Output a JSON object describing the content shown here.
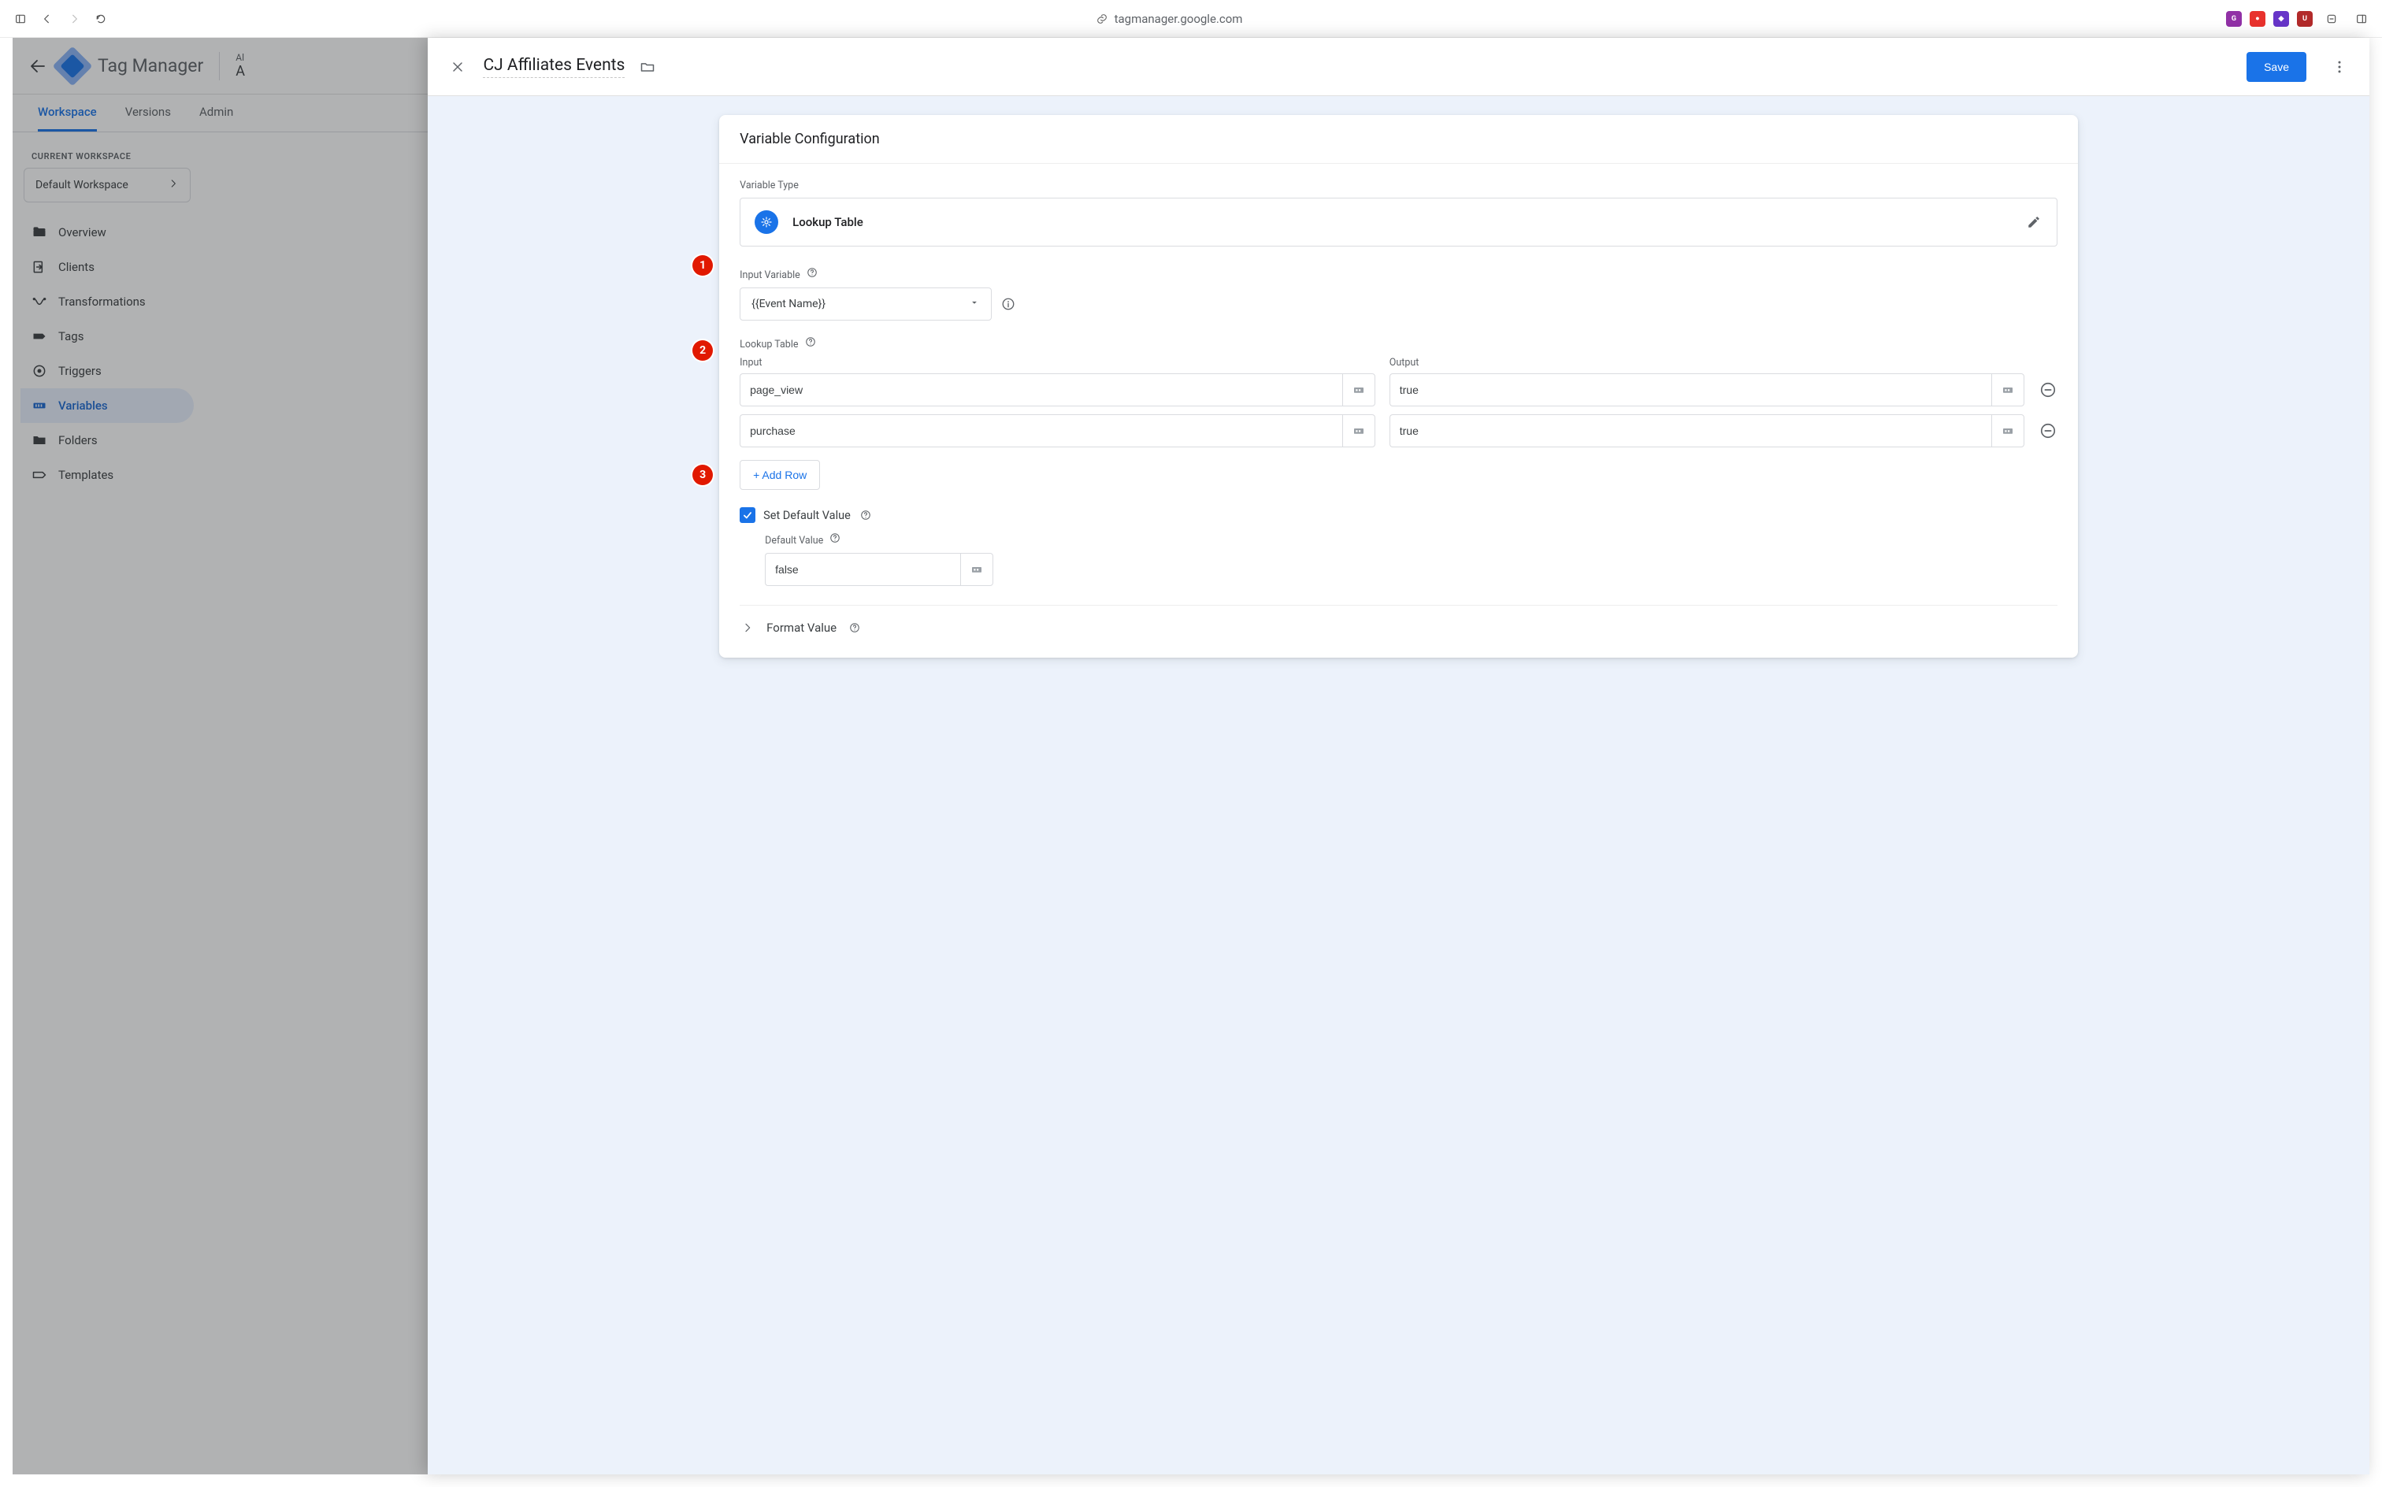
{
  "browser": {
    "url": "tagmanager.google.com"
  },
  "app": {
    "name": "Tag Manager",
    "account_top": "Al",
    "account_main": "A"
  },
  "tabs": {
    "workspace": "Workspace",
    "versions": "Versions",
    "admin": "Admin"
  },
  "sidebar": {
    "heading": "CURRENT WORKSPACE",
    "workspace_name": "Default Workspace",
    "items": {
      "overview": "Overview",
      "clients": "Clients",
      "transformations": "Transformations",
      "tags": "Tags",
      "triggers": "Triggers",
      "variables": "Variables",
      "folders": "Folders",
      "templates": "Templates"
    }
  },
  "panel": {
    "title": "CJ Affiliates Events",
    "save": "Save"
  },
  "config": {
    "header": "Variable Configuration",
    "variable_type_label": "Variable Type",
    "variable_type_name": "Lookup Table",
    "input_variable_label": "Input Variable",
    "input_variable_value": "{{Event Name}}",
    "lookup_table_label": "Lookup Table",
    "input_col": "Input",
    "output_col": "Output",
    "rows": [
      {
        "input": "page_view",
        "output": "true"
      },
      {
        "input": "purchase",
        "output": "true"
      }
    ],
    "add_row": "+ Add Row",
    "set_default_label": "Set Default Value",
    "default_value_label": "Default Value",
    "default_value": "false",
    "format_value": "Format Value"
  },
  "callouts": {
    "c1": "1",
    "c2": "2",
    "c3": "3"
  }
}
